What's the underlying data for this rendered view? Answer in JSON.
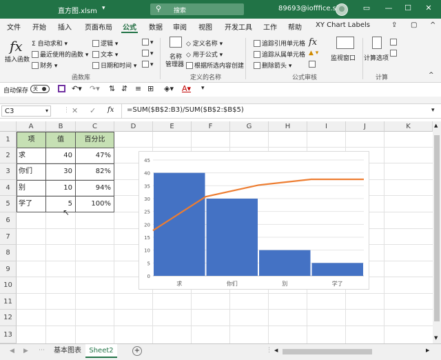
{
  "window": {
    "file_name": "直方图.xlsm",
    "file_dropdown": "▾",
    "search_placeholder": "搜索",
    "user": "89693@iofffice.site",
    "minimize": "—",
    "maximize": "☐",
    "close": "✕"
  },
  "menu": [
    "文件",
    "开始",
    "插入",
    "页面布局",
    "公式",
    "数据",
    "审阅",
    "视图",
    "开发工具",
    "工作",
    "帮助",
    "XY Chart Labels"
  ],
  "ribbon": {
    "insert_function": "插入函数",
    "fx": "fx",
    "autosum": "自动求和",
    "recent": "最近使用的函数",
    "finance": "财务",
    "logic": "逻辑",
    "text": "文本",
    "datetime": "日期和时间",
    "group_library": "函数库",
    "name_manager_1": "名称",
    "name_manager_2": "管理器",
    "define_name": "定义名称",
    "use_in_formula": "用于公式",
    "create_from_selection": "根据所选内容创建",
    "group_names": "定义的名称",
    "trace_precedents": "追踪引用单元格",
    "trace_dependents": "追踪从属单元格",
    "remove_arrows": "删除箭头",
    "watch_window": "监视窗口",
    "group_audit": "公式审核",
    "calc_options": "计算选项",
    "group_calc": "计算"
  },
  "qat": {
    "autosave": "自动保存",
    "toggle": "关"
  },
  "formula_bar": {
    "cell_ref": "C3",
    "formula": "=SUM($B$2:B3)/SUM($B$2:$B$5)",
    "cancel": "✕",
    "enter": "✓",
    "fx": "fx"
  },
  "columns": [
    "A",
    "B",
    "C",
    "D",
    "E",
    "F",
    "G",
    "H",
    "I",
    "J",
    "K"
  ],
  "rows": [
    "1",
    "2",
    "3",
    "4",
    "5",
    "6",
    "7",
    "8",
    "9",
    "10",
    "11",
    "12",
    "13"
  ],
  "table": {
    "headers": [
      "项",
      "值",
      "百分比"
    ],
    "rows": [
      [
        "求",
        "40",
        "47%"
      ],
      [
        "你们",
        "30",
        "82%"
      ],
      [
        "别",
        "10",
        "94%"
      ],
      [
        "学了",
        "5",
        "100%"
      ]
    ]
  },
  "chart_data": {
    "type": "bar",
    "categories": [
      "求",
      "你们",
      "别",
      "学了"
    ],
    "series": [
      {
        "type": "bar",
        "values": [
          40,
          30,
          10,
          5
        ],
        "color": "#4472c4"
      },
      {
        "type": "line",
        "values": [
          47,
          82,
          94,
          100
        ],
        "color": "#ed7d31"
      }
    ],
    "y_ticks": [
      "0",
      "5",
      "10",
      "15",
      "20",
      "25",
      "30",
      "35",
      "40",
      "45"
    ],
    "ylim": [
      0,
      45
    ],
    "y2lim": [
      0,
      120
    ],
    "grid": true
  },
  "sheets": [
    "基本图表",
    "Sheet2"
  ],
  "active_sheet": "Sheet2",
  "add_sheet": "+"
}
